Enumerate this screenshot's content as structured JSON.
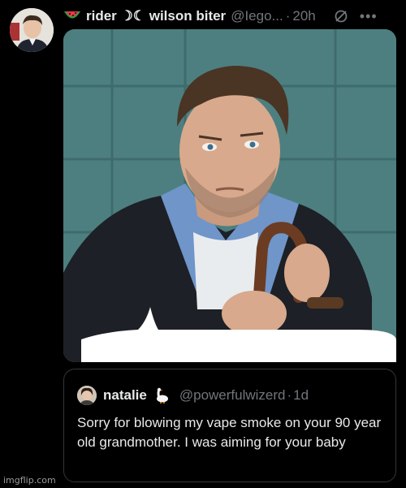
{
  "tweet": {
    "display_name": "rider ☽☾ wilson biter",
    "handle": "@Iego...",
    "separator": "·",
    "time": "20h",
    "more_label": "•••",
    "emoji_icon": "watermelon-icon"
  },
  "reply_bubble": {
    "color": "#ffffff"
  },
  "quote": {
    "name": "natalie",
    "emoji_icon": "goose-icon",
    "handle": "@powerfulwizerd",
    "separator": "·",
    "time": "1d",
    "text": "Sorry for blowing my vape smoke on your 90 year old grandmother. I was aiming for your baby"
  },
  "watermark": "imgflip.com",
  "colors": {
    "background": "#000000",
    "text": "#e7e9ea",
    "muted": "#71767b",
    "border": "#333639",
    "wall": "#4d7f80"
  }
}
